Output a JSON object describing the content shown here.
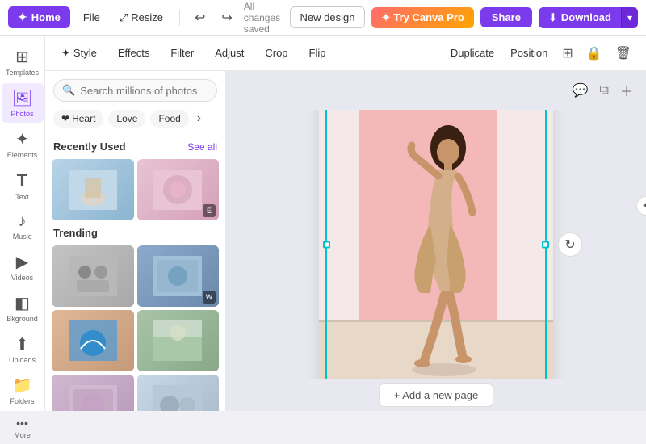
{
  "nav": {
    "home_label": "Home",
    "file_label": "File",
    "resize_label": "Resize",
    "saved_label": "All changes saved",
    "new_design_label": "New design",
    "try_canva_label": "Try Canva Pro",
    "share_label": "Share",
    "download_label": "Download"
  },
  "sidebar": {
    "items": [
      {
        "id": "templates",
        "icon": "⊞",
        "label": "Templates"
      },
      {
        "id": "photos",
        "icon": "🖼",
        "label": "Photos"
      },
      {
        "id": "elements",
        "icon": "✦",
        "label": "Elements"
      },
      {
        "id": "text",
        "icon": "T",
        "label": "Text"
      },
      {
        "id": "music",
        "icon": "♪",
        "label": "Music"
      },
      {
        "id": "videos",
        "icon": "▶",
        "label": "Videos"
      },
      {
        "id": "background",
        "icon": "◧",
        "label": "Bkground"
      },
      {
        "id": "uploads",
        "icon": "⬆",
        "label": "Uploads"
      },
      {
        "id": "folders",
        "icon": "📁",
        "label": "Folders"
      },
      {
        "id": "more",
        "icon": "•••",
        "label": "More"
      }
    ]
  },
  "photos_panel": {
    "search_placeholder": "Search millions of photos",
    "categories": [
      {
        "id": "heart",
        "label": "Heart"
      },
      {
        "id": "love",
        "label": "Love"
      },
      {
        "id": "food",
        "label": "Food"
      }
    ],
    "recently_used_label": "Recently Used",
    "see_all_label": "See all",
    "trending_label": "Trending"
  },
  "toolbar": {
    "style_label": "Style",
    "effects_label": "Effects",
    "filter_label": "Filter",
    "adjust_label": "Adjust",
    "crop_label": "Crop",
    "flip_label": "Flip",
    "duplicate_label": "Duplicate",
    "position_label": "Position"
  },
  "canvas": {
    "add_page_label": "+ Add a new page"
  }
}
